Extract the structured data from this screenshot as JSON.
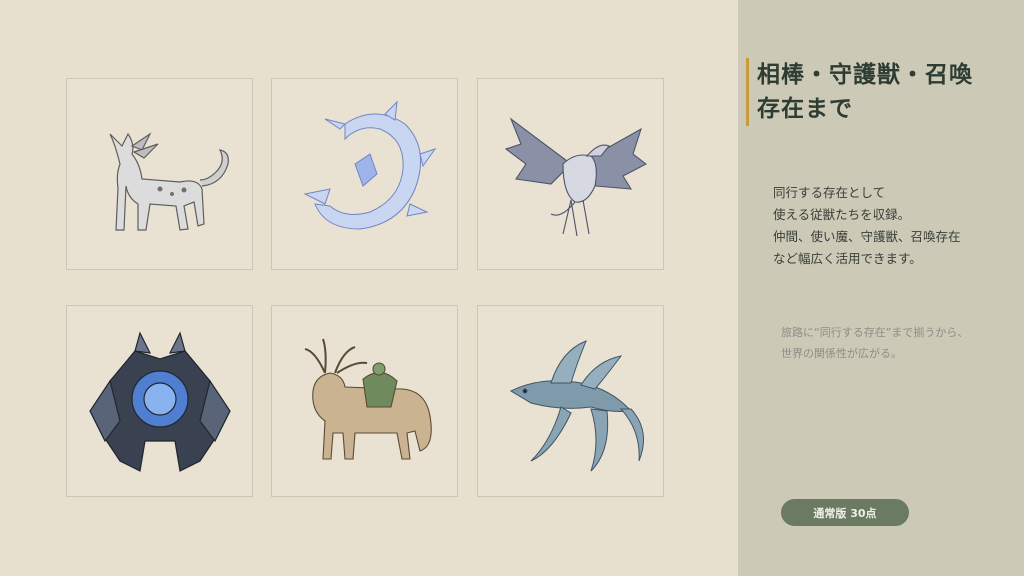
{
  "gallery": {
    "cards": [
      {
        "icon": "wolf-creature-illustration"
      },
      {
        "icon": "crystal-serpent-illustration"
      },
      {
        "icon": "winged-griffin-illustration"
      },
      {
        "icon": "armored-golem-illustration"
      },
      {
        "icon": "antlered-beast-illustration"
      },
      {
        "icon": "spirit-fish-illustration"
      }
    ]
  },
  "panel": {
    "title_line1": "相棒・守護獣・召喚",
    "title_line2": "存在まで",
    "desc": [
      "同行する存在として",
      "使える従獣たちを収録。",
      "仲間、使い魔、守護獣、召喚存在",
      "など幅広く活用できます。"
    ],
    "note": [
      "旅路に“同行する存在”まで揃うから、",
      "世界の関係性が広がる。"
    ],
    "badge": "通常版 30点"
  },
  "colors": {
    "background": "#e7e0cf",
    "panel": "#ccc9b7",
    "accent_bar": "#c79b3a",
    "badge": "#6b7a63",
    "title": "#2e3d33"
  }
}
